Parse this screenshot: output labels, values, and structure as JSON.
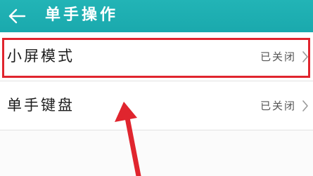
{
  "header": {
    "title": "单手操作",
    "back_icon": "back-arrow-icon",
    "background_color": "#1fb0b2"
  },
  "settings": [
    {
      "label": "小屏模式",
      "value": "已关闭",
      "icon": "chevron-right-icon"
    },
    {
      "label": "单手键盘",
      "value": "已关闭",
      "icon": "chevron-right-icon"
    }
  ],
  "annotation": {
    "highlight_color": "#e0252e",
    "arrow_color": "#e0252e"
  }
}
